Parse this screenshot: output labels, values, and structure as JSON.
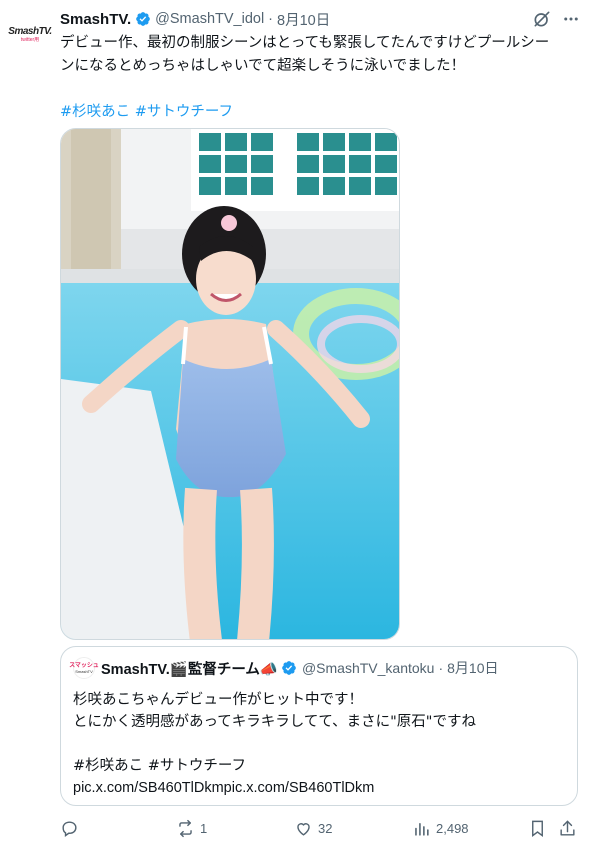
{
  "post": {
    "author": {
      "display_name": "SmashTV.",
      "handle": "@SmashTV_idol",
      "avatar_text": "SmashTV.",
      "avatar_subtext": "twitter用"
    },
    "separator": "·",
    "date": "8月10日",
    "text_line1": "デビュー作、最初の制服シーンはとっても緊張してたんですけどプールシー",
    "text_line2": "ンになるとめっちゃはしゃいでて超楽しそうに泳いでました！",
    "hashtag1": "#杉咲あこ",
    "hashtag2": "#サトウチーフ"
  },
  "quote": {
    "author": {
      "display_name": "SmashTV.🎬監督チーム📣",
      "handle": "@SmashTV_kantoku",
      "avatar_text": "スマッシュ",
      "avatar_subtext": "SmashTV"
    },
    "separator": "·",
    "date": "8月10日",
    "line1": "杉咲あこちゃんデビュー作がヒット中です！",
    "line2": "とにかく透明感があってキラキラしてて、まさに\"原石\"ですね",
    "hashtags": "#杉咲あこ #サトウチーフ",
    "link": "pic.x.com/SB460TlDkmpic.x.com/SB460TlDkm"
  },
  "actions": {
    "replies": "",
    "reposts": "1",
    "likes": "32",
    "views": "2,498"
  },
  "colors": {
    "accent": "#1d9bf0",
    "text": "#0f1419",
    "secondary": "#536471",
    "border": "#cfd9de"
  },
  "icons": [
    "verified-badge-icon",
    "grok-icon",
    "more-icon",
    "reply-icon",
    "repost-icon",
    "like-icon",
    "views-icon",
    "bookmark-icon",
    "share-icon"
  ]
}
